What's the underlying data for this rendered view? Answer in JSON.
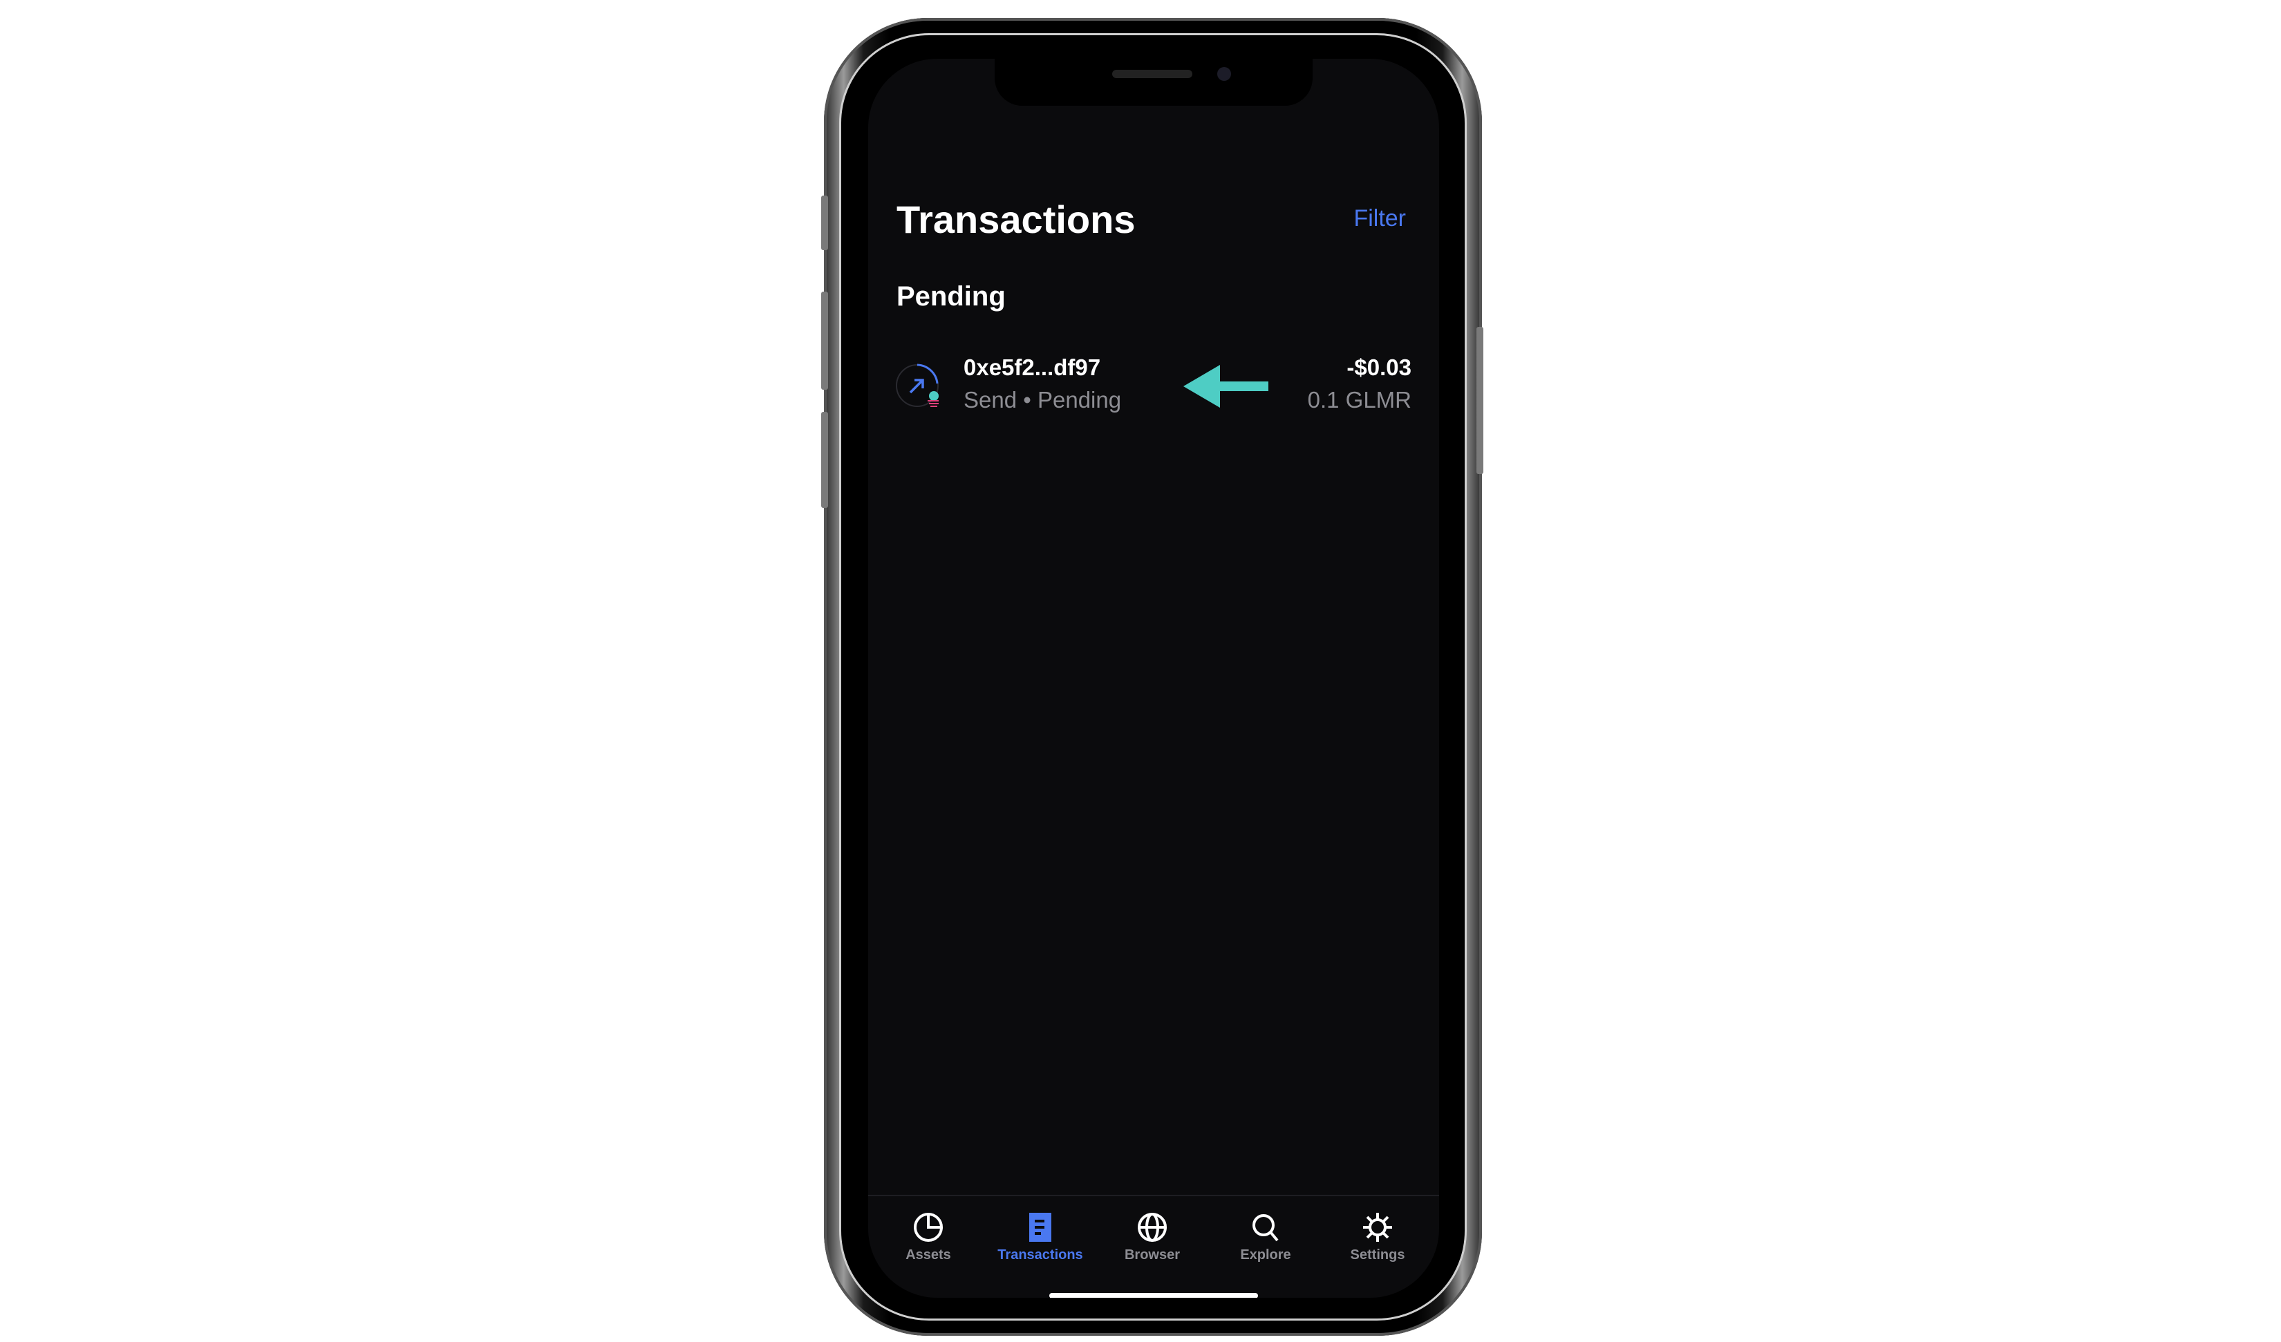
{
  "header": {
    "title": "Transactions",
    "filter_label": "Filter"
  },
  "section": {
    "title": "Pending"
  },
  "transactions": [
    {
      "address": "0xe5f2...df97",
      "type": "Send",
      "status": "Pending",
      "separator": "•",
      "fiat_amount": "-$0.03",
      "token_amount": "0.1 GLMR",
      "icon": "send-arrow-icon"
    }
  ],
  "tabs": [
    {
      "label": "Assets",
      "icon": "pie-chart-icon"
    },
    {
      "label": "Transactions",
      "icon": "document-list-icon",
      "active": true
    },
    {
      "label": "Browser",
      "icon": "globe-icon"
    },
    {
      "label": "Explore",
      "icon": "search-icon"
    },
    {
      "label": "Settings",
      "icon": "gear-icon"
    }
  ],
  "colors": {
    "accent": "#4a78f0",
    "annotation_arrow": "#4ecdc4",
    "background": "#0b0b0d"
  }
}
